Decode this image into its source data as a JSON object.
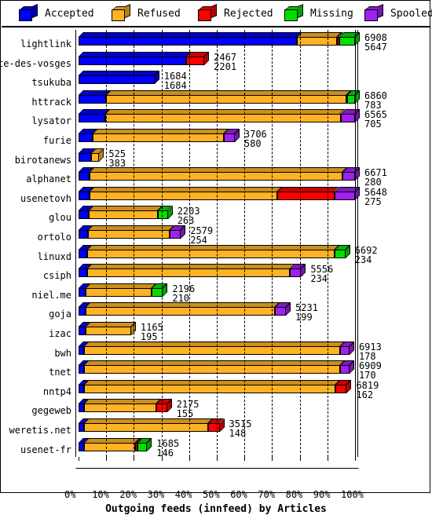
{
  "legend": {
    "items": [
      {
        "label": "Accepted",
        "color": "#0000ff",
        "icon": "cube-icon"
      },
      {
        "label": "Refused",
        "color": "#ffb224",
        "icon": "cube-icon"
      },
      {
        "label": "Rejected",
        "color": "#ff0000",
        "icon": "cube-icon"
      },
      {
        "label": "Missing",
        "color": "#00e000",
        "icon": "cube-icon"
      },
      {
        "label": "Spooled",
        "color": "#a020f0",
        "icon": "cube-icon"
      }
    ]
  },
  "chart_data": {
    "type": "bar",
    "orientation": "horizontal",
    "stacked": true,
    "title": "Outgoing feeds (innfeed) by Articles",
    "xlabel": "",
    "ylabel": "",
    "xlim": [
      0,
      100
    ],
    "xticks": [
      "0%",
      "10%",
      "20%",
      "30%",
      "40%",
      "50%",
      "60%",
      "70%",
      "80%",
      "90%",
      "100%"
    ],
    "grid": true,
    "legend_position": "top",
    "series_names": [
      "Accepted",
      "Refused",
      "Rejected",
      "Missing",
      "Spooled"
    ],
    "series_colors": [
      "#0000ff",
      "#ffb224",
      "#ff0000",
      "#00e000",
      "#a020f0"
    ],
    "categories": [
      "lightlink",
      "bete-des-vosges",
      "tsukuba",
      "httrack",
      "lysator",
      "furie",
      "birotanews",
      "alphanet",
      "usenetovh",
      "glou",
      "ortolo",
      "linuxd",
      "csiph",
      "niel.me",
      "goja",
      "izac",
      "bwh",
      "tnet",
      "nntp4",
      "gegeweb",
      "weretis.net",
      "usenet-fr"
    ],
    "rows": [
      {
        "name": "lightlink",
        "total": 6908,
        "accepted": 5647,
        "pct": [
          79.0,
          14.5,
          0.7,
          5.8,
          0.0
        ],
        "labels": [
          "6908",
          "5647"
        ]
      },
      {
        "name": "bete-des-vosges",
        "total": 2467,
        "accepted": 2201,
        "pct": [
          39.0,
          0.0,
          6.5,
          0.0,
          0.0
        ],
        "labels": [
          "2467",
          "2201"
        ]
      },
      {
        "name": "tsukuba",
        "total": 1684,
        "accepted": 1684,
        "pct": [
          27.5,
          0.0,
          0.0,
          0.0,
          0.0
        ],
        "labels": [
          "1684",
          "1684"
        ]
      },
      {
        "name": "httrack",
        "total": 6860,
        "accepted": 783,
        "pct": [
          10.0,
          86.8,
          0.4,
          2.8,
          0.0
        ],
        "labels": [
          "6860",
          "783"
        ]
      },
      {
        "name": "lysator",
        "total": 6565,
        "accepted": 705,
        "pct": [
          9.8,
          85.0,
          0.0,
          0.0,
          5.2
        ],
        "labels": [
          "6565",
          "705"
        ]
      },
      {
        "name": "furie",
        "total": 3706,
        "accepted": 580,
        "pct": [
          5.0,
          47.5,
          0.0,
          0.0,
          4.0
        ],
        "labels": [
          "3706",
          "580"
        ]
      },
      {
        "name": "birotanews",
        "total": 525,
        "accepted": 383,
        "pct": [
          4.5,
          3.0,
          0.0,
          0.0,
          0.0
        ],
        "labels": [
          "525",
          "383"
        ]
      },
      {
        "name": "alphanet",
        "total": 6671,
        "accepted": 280,
        "pct": [
          4.0,
          91.5,
          0.0,
          0.0,
          4.5
        ],
        "labels": [
          "6671",
          "280"
        ]
      },
      {
        "name": "usenetovh",
        "total": 5648,
        "accepted": 275,
        "pct": [
          4.0,
          68.0,
          20.5,
          0.0,
          7.5
        ],
        "labels": [
          "5648",
          "275"
        ]
      },
      {
        "name": "glou",
        "total": 2203,
        "accepted": 263,
        "pct": [
          3.8,
          25.0,
          0.0,
          3.5,
          0.0
        ],
        "labels": [
          "2203",
          "263"
        ]
      },
      {
        "name": "ortolo",
        "total": 2579,
        "accepted": 254,
        "pct": [
          3.5,
          29.5,
          0.0,
          0.0,
          4.0
        ],
        "labels": [
          "2579",
          "254"
        ]
      },
      {
        "name": "linuxd",
        "total": 6692,
        "accepted": 234,
        "pct": [
          3.0,
          89.5,
          0.0,
          4.0,
          0.0
        ],
        "labels": [
          "6692",
          "234"
        ]
      },
      {
        "name": "csiph",
        "total": 5556,
        "accepted": 234,
        "pct": [
          3.0,
          73.5,
          0.0,
          0.0,
          4.0
        ],
        "labels": [
          "5556",
          "234"
        ]
      },
      {
        "name": "niel.me",
        "total": 2196,
        "accepted": 210,
        "pct": [
          2.5,
          24.0,
          0.0,
          4.0,
          0.0
        ],
        "labels": [
          "2196",
          "210"
        ]
      },
      {
        "name": "goja",
        "total": 5231,
        "accepted": 199,
        "pct": [
          2.5,
          68.5,
          0.0,
          0.0,
          4.0
        ],
        "labels": [
          "5231",
          "199"
        ]
      },
      {
        "name": "izac",
        "total": 1165,
        "accepted": 195,
        "pct": [
          2.5,
          16.5,
          0.0,
          0.0,
          0.0
        ],
        "labels": [
          "1165",
          "195"
        ]
      },
      {
        "name": "bwh",
        "total": 6913,
        "accepted": 178,
        "pct": [
          2.0,
          92.5,
          0.0,
          0.0,
          3.5
        ],
        "labels": [
          "6913",
          "178"
        ]
      },
      {
        "name": "tnet",
        "total": 6909,
        "accepted": 170,
        "pct": [
          2.0,
          92.5,
          0.0,
          0.0,
          3.5
        ],
        "labels": [
          "6909",
          "170"
        ]
      },
      {
        "name": "nntp4",
        "total": 6819,
        "accepted": 162,
        "pct": [
          2.0,
          91.0,
          4.0,
          0.0,
          0.0
        ],
        "labels": [
          "6819",
          "162"
        ]
      },
      {
        "name": "gegeweb",
        "total": 2175,
        "accepted": 155,
        "pct": [
          2.0,
          26.0,
          4.0,
          0.0,
          0.0
        ],
        "labels": [
          "2175",
          "155"
        ]
      },
      {
        "name": "weretis.net",
        "total": 3515,
        "accepted": 148,
        "pct": [
          2.0,
          45.0,
          4.0,
          0.0,
          0.0
        ],
        "labels": [
          "3515",
          "148"
        ]
      },
      {
        "name": "usenet-fr",
        "total": 1685,
        "accepted": 146,
        "pct": [
          2.0,
          18.5,
          0.8,
          3.5,
          0.0
        ],
        "labels": [
          "1685",
          "146"
        ]
      }
    ]
  }
}
